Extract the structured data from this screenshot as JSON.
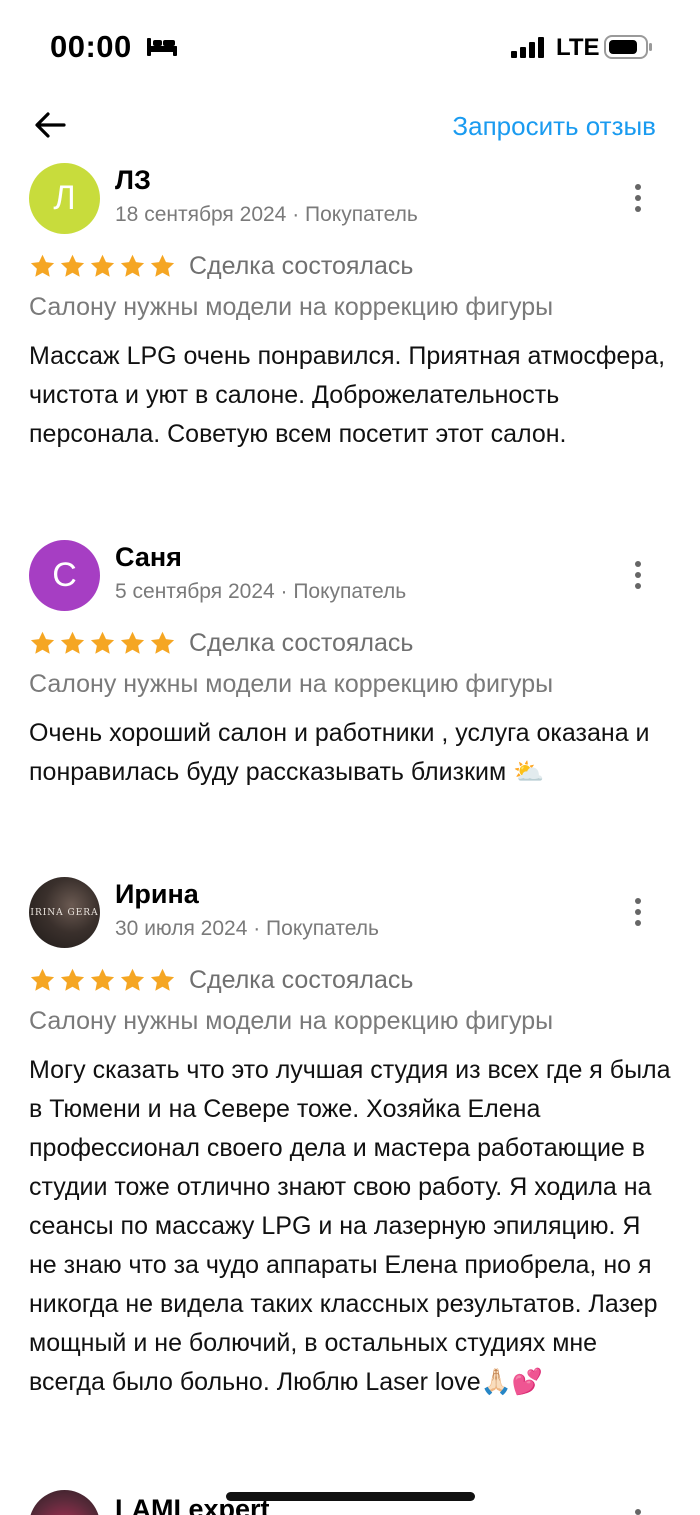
{
  "status_bar": {
    "time": "00:00",
    "network": "LTE"
  },
  "nav": {
    "back_icon": "arrow-left-icon",
    "action_label": "Запросить отзыв",
    "action_color": "#1a9bf0"
  },
  "reviews": [
    {
      "avatar_letter": "Л",
      "avatar_color": "#c8dc3c",
      "author": "ЛЗ",
      "meta": "18 сентября 2024 · Покупатель",
      "rating": 5,
      "deal_status": "Сделка состоялась",
      "service": "Салону нужны модели на коррекцию фигуры",
      "text": "Массаж LPG очень понравился. Приятная атмосфера, чистота и уют в салоне. Доброжелательность персонала. Советую всем посетит этот салон."
    },
    {
      "avatar_letter": "С",
      "avatar_color": "#a63ec3",
      "author": "Саня",
      "meta": "5 сентября 2024 · Покупатель",
      "rating": 5,
      "deal_status": "Сделка состоялась",
      "service": "Салону нужны модели на коррекцию фигуры",
      "text": "Очень хороший салон и работники , услуга оказана и понравилась буду рассказывать близким ⛅"
    },
    {
      "avatar_brand": "IRINA GERA",
      "author": "Ирина",
      "meta": "30 июля 2024 · Покупатель",
      "rating": 5,
      "deal_status": "Сделка состоялась",
      "service": "Салону нужны модели на коррекцию фигуры",
      "text": "Могу сказать что это лучшая студия из всех где я была в Тюмени и на Севере тоже. Хозяйка Елена профессионал своего дела и мастера работающие в студии тоже отлично знают свою работу. Я ходила на сеансы по массажу LPG и на лазерную эпиляцию. Я не знаю что за чудо аппараты Елена приобрела, но я никогда не видела таких классных результатов. Лазер мощный и не болючий, в остальных студиях мне всегда было больно. Люблю Laser love🙏🏻💕"
    },
    {
      "author": "LAMI expert"
    }
  ],
  "colors": {
    "star": "#f5a623",
    "muted_text": "#7a7a7a",
    "accent": "#1a9bf0"
  }
}
